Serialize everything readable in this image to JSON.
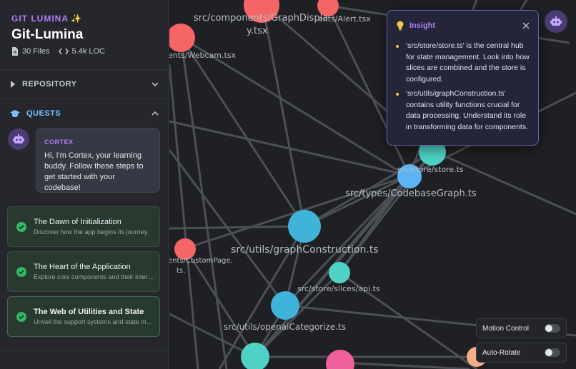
{
  "sidebar": {
    "brand": "GIT LUMINA",
    "repo_name": "Git-Lumina",
    "files": "30 Files",
    "loc": "5.4k LOC",
    "repository_label": "REPOSITORY",
    "quests_label": "QUESTS",
    "cortex": {
      "name": "CORTEX",
      "message": "Hi, I'm Cortex, your learning buddy. Follow these steps to get started with your codebase!"
    },
    "quests": [
      {
        "title": "The Dawn of Initialization",
        "desc": "Discover how the app begins its journey."
      },
      {
        "title": "The Heart of the Application",
        "desc": "Explore core components and their interactions."
      },
      {
        "title": "The Web of Utilities and State",
        "desc": "Unveil the support systems and state management."
      }
    ]
  },
  "graph": {
    "labels": {
      "graph_display_a": "src/components/GraphDispla",
      "graph_display_b": "y.tsx",
      "alert": "ents/Alert.tsx",
      "webcam": "ents/Webcam.tsx",
      "store": "src/store/store.ts",
      "codebase_graph": "src/types/CodebaseGraph.ts",
      "graph_construction": "src/utils/graphConstruction.ts",
      "custom_page_a": "ents/CustomPage.",
      "custom_page_b": "ts.",
      "api": "src/store/slices/api.ts",
      "categorize": "src/utils/openaiCategorize.ts"
    },
    "colors": {
      "teal": "#4fd1c5",
      "blue": "#5ab4f5",
      "cyan": "#3fb3d8",
      "red": "#f56565",
      "pink": "#f0609a",
      "edge": "#55575f"
    }
  },
  "insight": {
    "title": "Insight",
    "items": [
      "'src/store/store.ts' is the central hub for state management. Look into how slices are combined and the store is configured.",
      "'src/utils/graphConstruction.ts' contains utility functions crucial for data processing. Understand its role in transforming data for components."
    ]
  },
  "controls": {
    "motion_control": "Motion Control",
    "auto_rotate": "Auto-Rotate"
  }
}
